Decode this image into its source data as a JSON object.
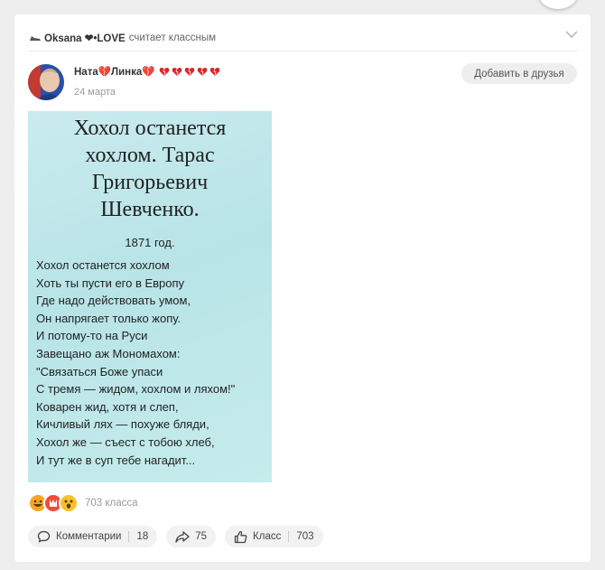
{
  "activity": {
    "user": "Oksana ❤•LOVE",
    "action": "считает классным"
  },
  "post": {
    "author": "Ната💔Линка💔",
    "author_hearts": 5,
    "date": "24 марта",
    "add_friend_label": "Добавить в друзья"
  },
  "image_text": {
    "title": "Хохол останется\nхохлом. Тарас\nГригорьевич\nШевченко.",
    "year": "1871 год.",
    "poem": "Хохол останется хохлом\nХоть ты пусти его в Европу\nГде надо действовать умом,\nОн напрягает только жопу.\nИ потому-то на Руси\nЗавещано аж Мономахом:\n\"Связаться Боже упаси\nС тремя — жидом, хохлом и ляхом!\"\nКоварен жид, хотя и слеп,\nКичливый лях — похуже бляди,\nХохол же — съест с тобою хлеб,\nИ тут же в суп тебе нагадит..."
  },
  "reactions": {
    "count_text": "703 класса",
    "icons": [
      "laugh-reaction-icon",
      "wow-reaction-icon",
      "surprised-reaction-icon"
    ]
  },
  "actions": {
    "comments_label": "Комментарии",
    "comments_count": "18",
    "share_count": "75",
    "like_label": "Класс",
    "like_count": "703"
  },
  "colors": {
    "heart": "#d9262c",
    "image_bg": "#c3e8ea",
    "page_bg": "#eeeeee"
  }
}
